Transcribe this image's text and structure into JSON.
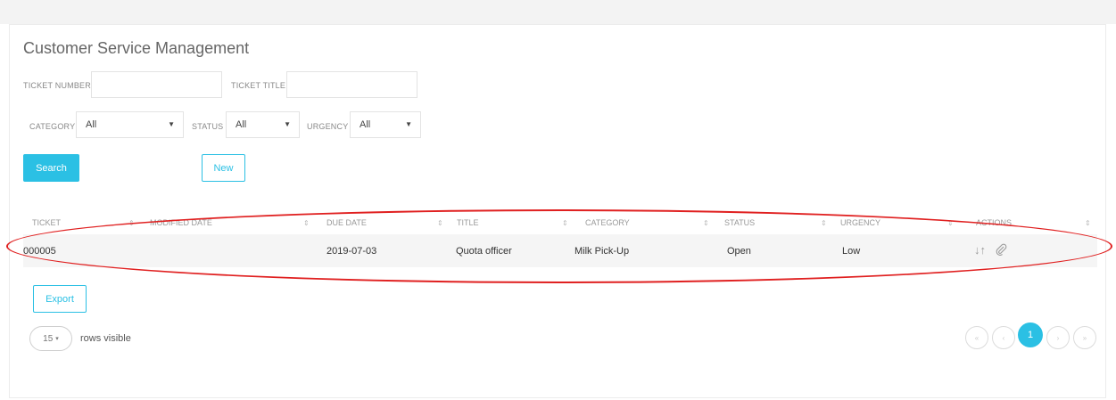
{
  "page_title": "Customer Service Management",
  "filters": {
    "ticket_number_label": "TICKET NUMBER",
    "ticket_number_value": "",
    "ticket_title_label": "TICKET TITLE",
    "ticket_title_value": "",
    "category_label": "CATEGORY",
    "category_value": "All",
    "status_label": "STATUS",
    "status_value": "All",
    "urgency_label": "URGENCY",
    "urgency_value": "All"
  },
  "buttons": {
    "search": "Search",
    "new": "New",
    "export": "Export"
  },
  "table": {
    "columns": [
      "TICKET",
      "MODIFIED DATE",
      "DUE DATE",
      "TITLE",
      "CATEGORY",
      "STATUS",
      "URGENCY",
      "ACTIONS"
    ],
    "rows": [
      {
        "ticket": "000005",
        "modified_date": "",
        "due_date": "2019-07-03",
        "title": "Quota officer",
        "category": "Milk Pick-Up",
        "status": "Open",
        "urgency": "Low",
        "actions": [
          "reorder-icon",
          "attachment-icon"
        ]
      }
    ]
  },
  "footer": {
    "rows_per_page": "15",
    "rows_visible_label": "rows visible"
  },
  "pagination": {
    "first": "«",
    "prev": "‹",
    "current": "1",
    "next": "›",
    "last": "»"
  },
  "colors": {
    "accent": "#2bc0e4",
    "annotation": "#e02020"
  }
}
